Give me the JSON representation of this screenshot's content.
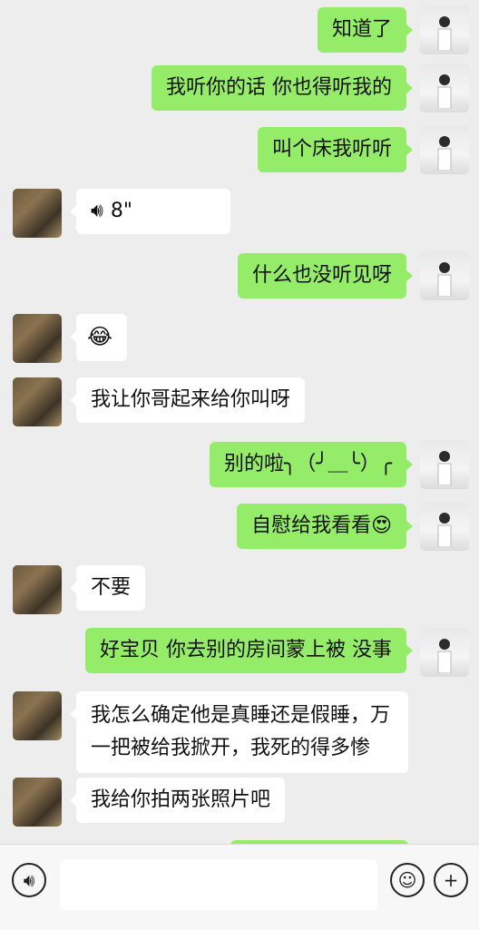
{
  "messages": [
    {
      "side": "me",
      "text": "知道了"
    },
    {
      "side": "me",
      "text": "我听你的话 你也得听我的"
    },
    {
      "side": "me",
      "text": "叫个床我听听"
    },
    {
      "side": "her",
      "type": "voice",
      "text": "8\""
    },
    {
      "side": "me",
      "text": "什么也没听见呀"
    },
    {
      "side": "her",
      "type": "emoji",
      "text": "😂"
    },
    {
      "side": "her",
      "text": "我让你哥起来给你叫呀"
    },
    {
      "side": "me",
      "text": "别的啦╮（╯＿╰）╭"
    },
    {
      "side": "me",
      "text": "自慰给我看看😍"
    },
    {
      "side": "her",
      "text": "不要"
    },
    {
      "side": "me",
      "text": "好宝贝 你去别的房间蒙上被 没事"
    },
    {
      "side": "her",
      "text": "我怎么确定他是真睡还是假睡，万一把被给我掀开，我死的得多惨"
    },
    {
      "side": "her",
      "text": "我给你拍两张照片吧"
    }
  ],
  "input": {
    "placeholder": ""
  },
  "icons": {
    "voice": "voice-icon",
    "emoji": "emoji-icon",
    "add": "add-icon"
  },
  "colors": {
    "my_bubble": "#95ec69",
    "her_bubble": "#ffffff",
    "background": "#ededed"
  }
}
